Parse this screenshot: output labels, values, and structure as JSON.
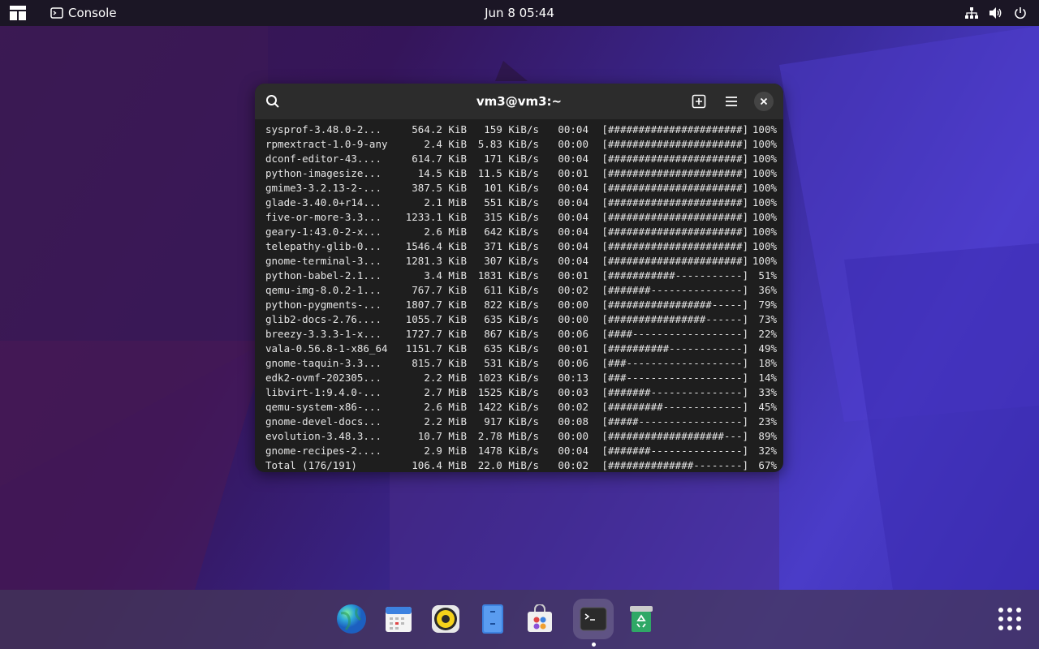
{
  "topbar": {
    "app_name": "Console",
    "clock": "Jun 8  05:44"
  },
  "terminal": {
    "title": "vm3@vm3:~",
    "rows": [
      {
        "name": "sysprof-3.48.0-2...",
        "size": "564.2 KiB",
        "speed": "159 KiB/s",
        "time": "00:04",
        "bar": "[######################]",
        "pct": "100%"
      },
      {
        "name": "rpmextract-1.0-9-any",
        "size": "2.4 KiB",
        "speed": "5.83 KiB/s",
        "time": "00:00",
        "bar": "[######################]",
        "pct": "100%"
      },
      {
        "name": "dconf-editor-43....",
        "size": "614.7 KiB",
        "speed": "171 KiB/s",
        "time": "00:04",
        "bar": "[######################]",
        "pct": "100%"
      },
      {
        "name": "python-imagesize...",
        "size": "14.5 KiB",
        "speed": "11.5 KiB/s",
        "time": "00:01",
        "bar": "[######################]",
        "pct": "100%"
      },
      {
        "name": "gmime3-3.2.13-2-...",
        "size": "387.5 KiB",
        "speed": "101 KiB/s",
        "time": "00:04",
        "bar": "[######################]",
        "pct": "100%"
      },
      {
        "name": "glade-3.40.0+r14...",
        "size": "2.1 MiB",
        "speed": "551 KiB/s",
        "time": "00:04",
        "bar": "[######################]",
        "pct": "100%"
      },
      {
        "name": "five-or-more-3.3...",
        "size": "1233.1 KiB",
        "speed": "315 KiB/s",
        "time": "00:04",
        "bar": "[######################]",
        "pct": "100%"
      },
      {
        "name": "geary-1:43.0-2-x...",
        "size": "2.6 MiB",
        "speed": "642 KiB/s",
        "time": "00:04",
        "bar": "[######################]",
        "pct": "100%"
      },
      {
        "name": "telepathy-glib-0...",
        "size": "1546.4 KiB",
        "speed": "371 KiB/s",
        "time": "00:04",
        "bar": "[######################]",
        "pct": "100%"
      },
      {
        "name": "gnome-terminal-3...",
        "size": "1281.3 KiB",
        "speed": "307 KiB/s",
        "time": "00:04",
        "bar": "[######################]",
        "pct": "100%"
      },
      {
        "name": "python-babel-2.1...",
        "size": "3.4 MiB",
        "speed": "1831 KiB/s",
        "time": "00:01",
        "bar": "[###########-----------]",
        "pct": "51%"
      },
      {
        "name": "qemu-img-8.0.2-1...",
        "size": "767.7 KiB",
        "speed": "611 KiB/s",
        "time": "00:02",
        "bar": "[#######---------------]",
        "pct": "36%"
      },
      {
        "name": "python-pygments-...",
        "size": "1807.7 KiB",
        "speed": "822 KiB/s",
        "time": "00:00",
        "bar": "[#################-----]",
        "pct": "79%"
      },
      {
        "name": "glib2-docs-2.76....",
        "size": "1055.7 KiB",
        "speed": "635 KiB/s",
        "time": "00:00",
        "bar": "[################------]",
        "pct": "73%"
      },
      {
        "name": "breezy-3.3.3-1-x...",
        "size": "1727.7 KiB",
        "speed": "867 KiB/s",
        "time": "00:06",
        "bar": "[####------------------]",
        "pct": "22%"
      },
      {
        "name": "vala-0.56.8-1-x86_64",
        "size": "1151.7 KiB",
        "speed": "635 KiB/s",
        "time": "00:01",
        "bar": "[##########------------]",
        "pct": "49%"
      },
      {
        "name": "gnome-taquin-3.3...",
        "size": "815.7 KiB",
        "speed": "531 KiB/s",
        "time": "00:06",
        "bar": "[###-------------------]",
        "pct": "18%"
      },
      {
        "name": "edk2-ovmf-202305...",
        "size": "2.2 MiB",
        "speed": "1023 KiB/s",
        "time": "00:13",
        "bar": "[###-------------------]",
        "pct": "14%"
      },
      {
        "name": "libvirt-1:9.4.0-...",
        "size": "2.7 MiB",
        "speed": "1525 KiB/s",
        "time": "00:03",
        "bar": "[#######---------------]",
        "pct": "33%"
      },
      {
        "name": "qemu-system-x86-...",
        "size": "2.6 MiB",
        "speed": "1422 KiB/s",
        "time": "00:02",
        "bar": "[#########-------------]",
        "pct": "45%"
      },
      {
        "name": "gnome-devel-docs...",
        "size": "2.2 MiB",
        "speed": "917 KiB/s",
        "time": "00:08",
        "bar": "[#####-----------------]",
        "pct": "23%"
      },
      {
        "name": "evolution-3.48.3...",
        "size": "10.7 MiB",
        "speed": "2.78 MiB/s",
        "time": "00:00",
        "bar": "[###################---]",
        "pct": "89%"
      },
      {
        "name": "gnome-recipes-2....",
        "size": "2.9 MiB",
        "speed": "1478 KiB/s",
        "time": "00:04",
        "bar": "[#######---------------]",
        "pct": "32%"
      },
      {
        "name": "Total (176/191)",
        "size": "106.4 MiB",
        "speed": "22.0 MiB/s",
        "time": "00:02",
        "bar": "[##############--------]",
        "pct": "67%"
      }
    ]
  },
  "dock": {
    "items": [
      {
        "name": "web-browser",
        "icon": "globe-icon"
      },
      {
        "name": "calendar",
        "icon": "calendar-icon"
      },
      {
        "name": "music-player",
        "icon": "speaker-icon"
      },
      {
        "name": "file-manager",
        "icon": "files-icon"
      },
      {
        "name": "software-center",
        "icon": "store-icon"
      },
      {
        "name": "console",
        "icon": "terminal-icon",
        "active": true
      },
      {
        "name": "trash",
        "icon": "trash-icon"
      }
    ]
  },
  "colors": {
    "topbar_bg": "#1b1625",
    "terminal_bg": "#1e1e1e",
    "terminal_header": "#2c2c2c",
    "terminal_text": "#e5e5e5"
  }
}
